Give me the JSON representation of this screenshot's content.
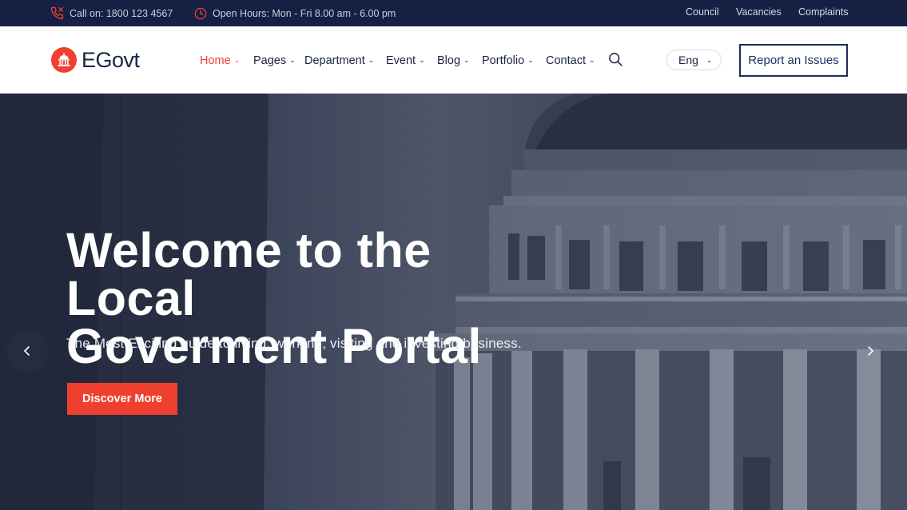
{
  "topbar": {
    "phone_text": "Call on: 1800 123 4567",
    "hours_text": "Open Hours: Mon - Fri 8.00 am - 6.00 pm",
    "links": [
      "Council",
      "Vacancies",
      "Complaints"
    ]
  },
  "header": {
    "logo_text": "EGovt",
    "nav": [
      {
        "label": "Home",
        "active": true
      },
      {
        "label": "Pages"
      },
      {
        "label": "Department"
      },
      {
        "label": "Event"
      },
      {
        "label": "Blog"
      },
      {
        "label": "Portfolio"
      },
      {
        "label": "Contact"
      }
    ],
    "language": "Eng",
    "report_label": "Report an Issues"
  },
  "hero": {
    "title_line1": "Welcome to the Local",
    "title_line2": "Goverment Portal",
    "subtitle": "The Most Exciting guide to living, working, visiting and investing business.",
    "cta_label": "Discover More"
  },
  "colors": {
    "accent": "#ef3f2e",
    "topbar_bg": "#152042",
    "navy": "#1c2b5e"
  },
  "icons": {
    "phone": "phone-icon",
    "clock": "clock-icon",
    "search": "search-icon",
    "prev": "chevron-left-icon",
    "next": "chevron-right-icon"
  }
}
